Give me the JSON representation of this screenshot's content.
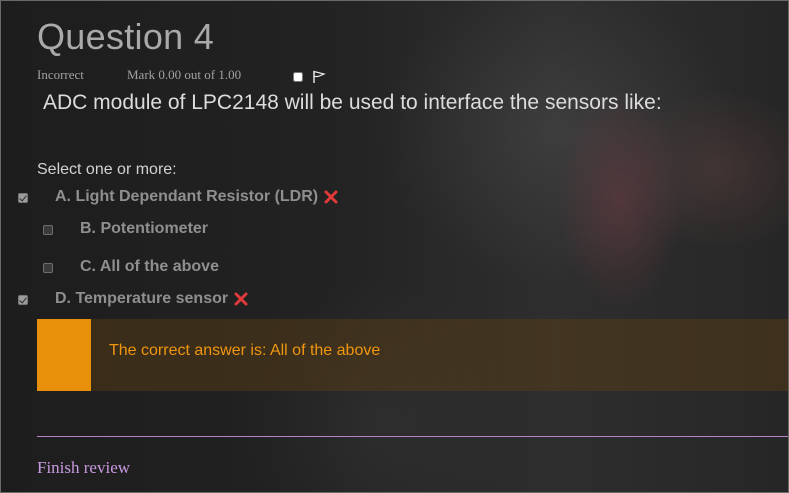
{
  "question": {
    "title": "Question 4",
    "state": "Incorrect",
    "grade": "Mark 0.00 out of 1.00",
    "text": "ADC module of LPC2148 will be used to interface the sensors like:",
    "prompt": "Select one or more:",
    "flag_icon": "flag-icon"
  },
  "options": [
    {
      "label": "A. Light Dependant Resistor (LDR)",
      "checked": true,
      "mark": "incorrect"
    },
    {
      "label": "B. Potentiometer",
      "checked": false,
      "mark": ""
    },
    {
      "label": "C. All of the above",
      "checked": false,
      "mark": ""
    },
    {
      "label": "D. Temperature sensor",
      "checked": true,
      "mark": "incorrect"
    }
  ],
  "feedback": {
    "text": "The correct answer is: All of the above"
  },
  "footer": {
    "finish_review": "Finish review"
  },
  "colors": {
    "feedback_accent": "#e8900a",
    "incorrect_mark": "#e03a3a",
    "link": "#c99ae0"
  }
}
